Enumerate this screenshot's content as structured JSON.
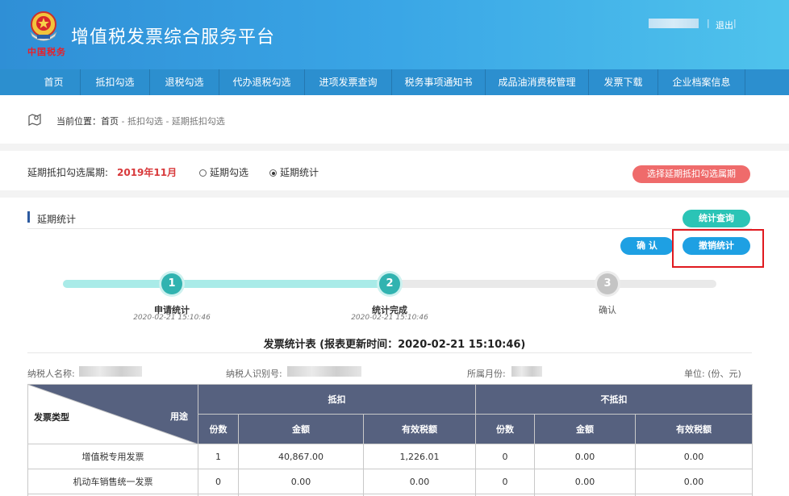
{
  "header": {
    "app_title": "增值税发票综合服务平台",
    "emblem_text": "中国税务",
    "logout_label": "退出",
    "separator": "|"
  },
  "nav": {
    "items": [
      "首页",
      "抵扣勾选",
      "退税勾选",
      "代办退税勾选",
      "进项发票查询",
      "税务事项通知书",
      "成品油消费税管理",
      "发票下载",
      "企业档案信息"
    ]
  },
  "breadcrumb": {
    "prefix": "当前位置：",
    "home": "首页",
    "path": " - 抵扣勾选 - 延期抵扣勾选"
  },
  "period": {
    "label": "延期抵扣勾选属期:",
    "value": "2019年11月",
    "radio_options": [
      "延期勾选",
      "延期统计"
    ],
    "selected_index": 1,
    "select_button": "选择延期抵扣勾选属期"
  },
  "section": {
    "title": "延期统计",
    "query_button": "统计查询",
    "confirm_button": "确 认",
    "cancel_button": "撤销统计"
  },
  "steps": [
    {
      "number": "1",
      "label": "申请统计",
      "time": "2020-02-21 15:10:46",
      "state": "done"
    },
    {
      "number": "2",
      "label": "统计完成",
      "time": "2020-02-21 15:10:46",
      "state": "done"
    },
    {
      "number": "3",
      "label": "确认",
      "time": "",
      "state": "todo"
    }
  ],
  "report": {
    "title": "发票统计表  (报表更新时间：2020-02-21 15:10:46)",
    "taxpayer_name_label": "纳税人名称:",
    "taxpayer_id_label": "纳税人识别号:",
    "month_label": "所属月份:",
    "unit_label": "单位:    (份、元)"
  },
  "table": {
    "corner_left": "发票类型",
    "corner_right": "用途",
    "group_deduct": "抵扣",
    "group_nondeduct": "不抵扣",
    "sub_headers": [
      "份数",
      "金额",
      "有效税额",
      "份数",
      "金额",
      "有效税额"
    ],
    "rows": [
      {
        "type": "增值税专用发票",
        "cells": [
          "1",
          "40,867.00",
          "1,226.01",
          "0",
          "0.00",
          "0.00"
        ]
      },
      {
        "type": "机动车销售统一发票",
        "cells": [
          "0",
          "0.00",
          "0.00",
          "0",
          "0.00",
          "0.00"
        ]
      }
    ]
  }
}
